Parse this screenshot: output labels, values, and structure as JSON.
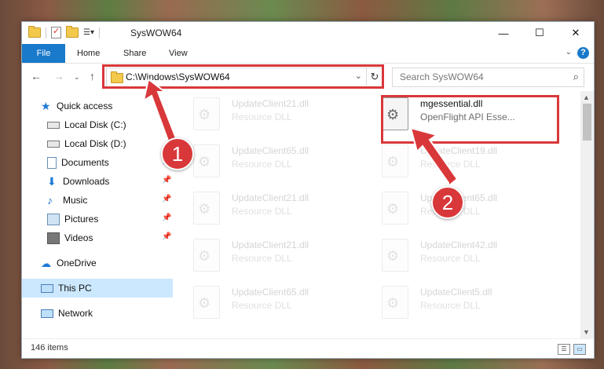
{
  "window": {
    "title": "SysWOW64"
  },
  "ribbon": {
    "tabs": [
      {
        "label": "File"
      },
      {
        "label": "Home"
      },
      {
        "label": "Share"
      },
      {
        "label": "View"
      }
    ]
  },
  "nav": {
    "address_path": "C:\\Windows\\SysWOW64",
    "search_placeholder": "Search SysWOW64"
  },
  "sidebar": {
    "items": [
      {
        "label": "Quick access"
      },
      {
        "label": "Local Disk (C:)"
      },
      {
        "label": "Local Disk (D:)"
      },
      {
        "label": "Documents"
      },
      {
        "label": "Downloads"
      },
      {
        "label": "Music"
      },
      {
        "label": "Pictures"
      },
      {
        "label": "Videos"
      },
      {
        "label": "OneDrive"
      },
      {
        "label": "This PC"
      },
      {
        "label": "Network"
      }
    ]
  },
  "files": [
    {
      "name": "UpdateClient21.dll",
      "type": "Resource DLL"
    },
    {
      "name": "mgessential.dll",
      "type": "OpenFlight API Esse..."
    },
    {
      "name": "UpdateClient65.dll",
      "type": "Resource DLL"
    },
    {
      "name": "UpdateClient19.dll",
      "type": "Resource DLL"
    },
    {
      "name": "UpdateClient21.dll",
      "type": "Resource DLL"
    },
    {
      "name": "UpdateClient65.dll",
      "type": "Resource DLL"
    },
    {
      "name": "UpdateClient21.dll",
      "type": "Resource DLL"
    },
    {
      "name": "UpdateClient42.dll",
      "type": "Resource DLL"
    },
    {
      "name": "UpdateClient65.dll",
      "type": "Resource DLL"
    },
    {
      "name": "UpdateClient5.dll",
      "type": "Resource DLL"
    }
  ],
  "status": {
    "item_count": "146 items"
  },
  "annotations": {
    "step1": "1",
    "step2": "2",
    "accent_color": "#d9383a"
  }
}
